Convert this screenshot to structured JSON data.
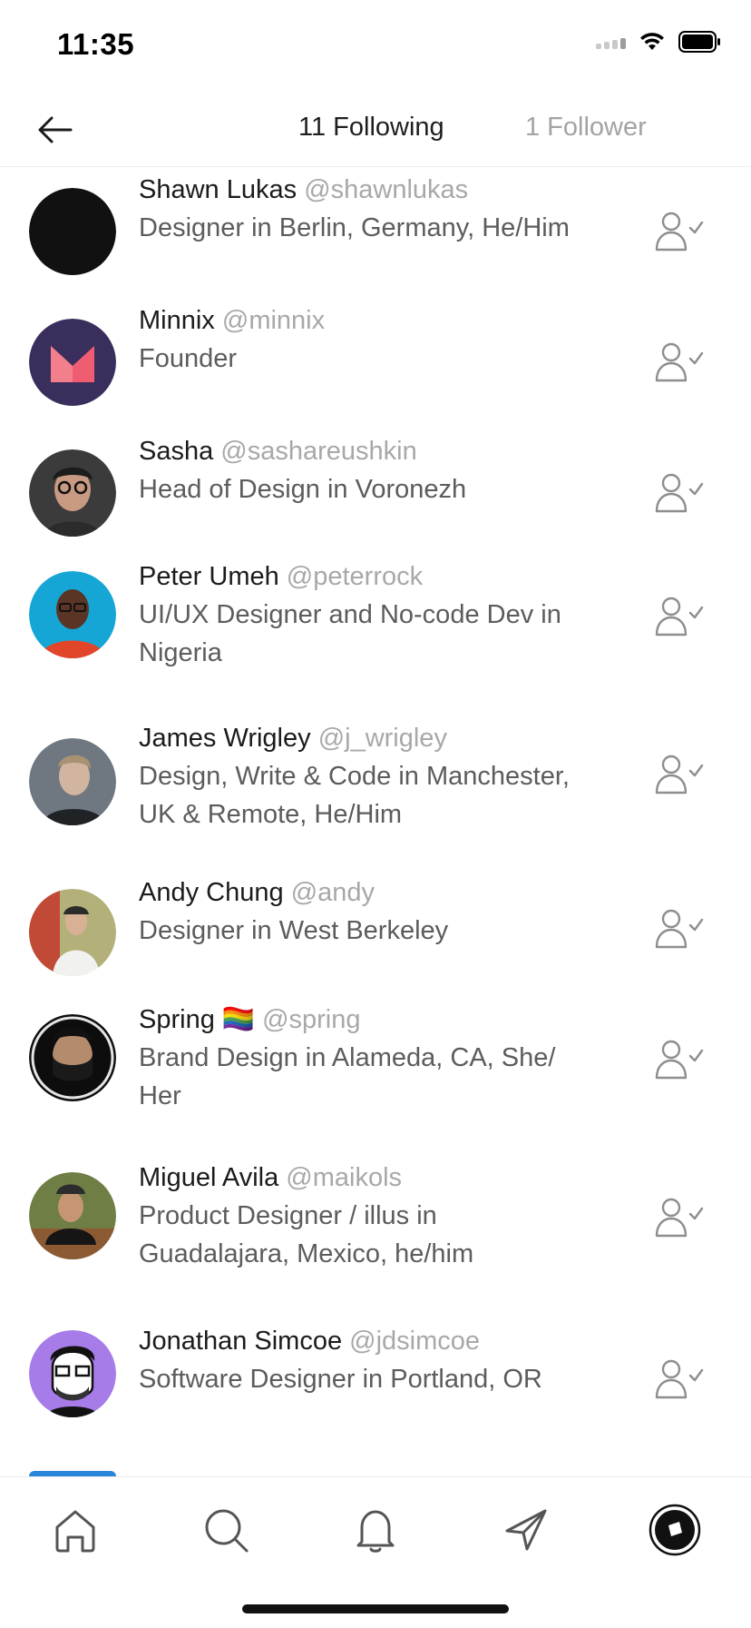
{
  "status_bar": {
    "time": "11:35"
  },
  "header": {
    "tabs": [
      {
        "label": "11 Following",
        "active": true
      },
      {
        "label": "1 Follower",
        "active": false
      }
    ]
  },
  "users": [
    {
      "name": "Shawn Lukas",
      "handle": "@shawnlukas",
      "bio_lines": [
        "Designer in Berlin, Germany, He/Him"
      ]
    },
    {
      "name": "Minnix",
      "handle": "@minnix",
      "bio_lines": [
        "Founder"
      ]
    },
    {
      "name": "Sasha",
      "handle": "@sashareushkin",
      "bio_lines": [
        "Head of Design in Voronezh"
      ]
    },
    {
      "name": "Peter Umeh",
      "handle": "@peterrock",
      "bio_lines": [
        "UI/UX Designer and No-code Dev in",
        "Nigeria"
      ]
    },
    {
      "name": "James Wrigley",
      "handle": "@j_wrigley",
      "bio_lines": [
        "Design, Write & Code in Manchester,",
        "UK & Remote, He/Him"
      ]
    },
    {
      "name": "Andy Chung",
      "handle": "@andy",
      "bio_lines": [
        "Designer in West Berkeley"
      ]
    },
    {
      "name": "Spring",
      "name_emoji": "🏳️‍🌈",
      "handle": "@spring",
      "bio_lines": [
        "Brand Design in Alameda, CA, She/",
        "Her"
      ]
    },
    {
      "name": "Miguel Avila",
      "handle": "@maikols",
      "bio_lines": [
        "Product Designer / illus in",
        "Guadalajara, Mexico, he/him"
      ]
    },
    {
      "name": "Jonathan Simcoe",
      "handle": "@jdsimcoe",
      "bio_lines": [
        "Software Designer in Portland, OR"
      ]
    }
  ],
  "icons": {
    "follow_state": "user-check-icon",
    "tabbar": [
      "home-icon",
      "search-icon",
      "bell-icon",
      "send-icon",
      "profile-avatar-icon"
    ]
  },
  "colors": {
    "text_primary": "#1b1b1b",
    "text_secondary": "#5c5c5c",
    "handle": "#a8a8a8",
    "icon": "#8e8e8e"
  }
}
